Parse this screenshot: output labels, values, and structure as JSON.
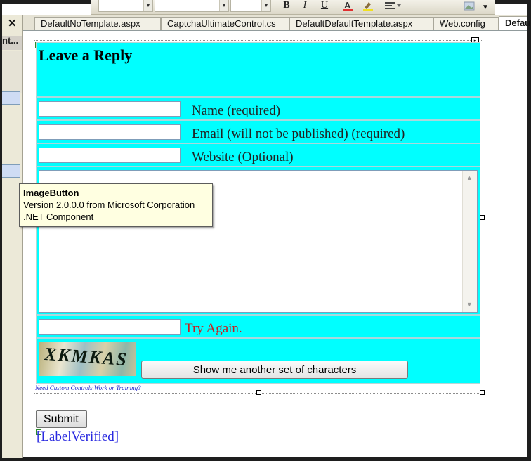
{
  "toolbar": {
    "buttons": {
      "bold": "B",
      "italic": "I",
      "underline": "U"
    }
  },
  "left_panel": {
    "close_label": "✕",
    "title": "nt..."
  },
  "tabs": [
    {
      "label": "DefaultNoTemplate.aspx"
    },
    {
      "label": "CaptchaUltimateControl.cs"
    },
    {
      "label": "DefaultDefaultTemplate.aspx"
    },
    {
      "label": "Web.config"
    },
    {
      "label": "Defau"
    }
  ],
  "form": {
    "title": "Leave a Reply",
    "name_label": "Name (required)",
    "email_label": "Email (will not be published) (required)",
    "website_label": "Website (Optional)",
    "name_value": "",
    "email_value": "",
    "website_value": "",
    "comment_value": "",
    "captcha_value": "",
    "try_again": "Try Again.",
    "captcha_text": "XKMKAS",
    "show_button": "Show me another set of characters",
    "promo_link": "Need Custom Controls Work or Training?",
    "submit": "Submit",
    "label_verified": "[LabelVerified]"
  },
  "tooltip": {
    "title": "ImageButton",
    "line1": "Version 2.0.0.0 from Microsoft Corporation",
    "line2": ".NET Component"
  },
  "colors": {
    "form_bg": "#00ffff",
    "error": "#c8201e",
    "label_verified": "#2a2ae0",
    "tooltip_bg": "#ffffe1"
  }
}
